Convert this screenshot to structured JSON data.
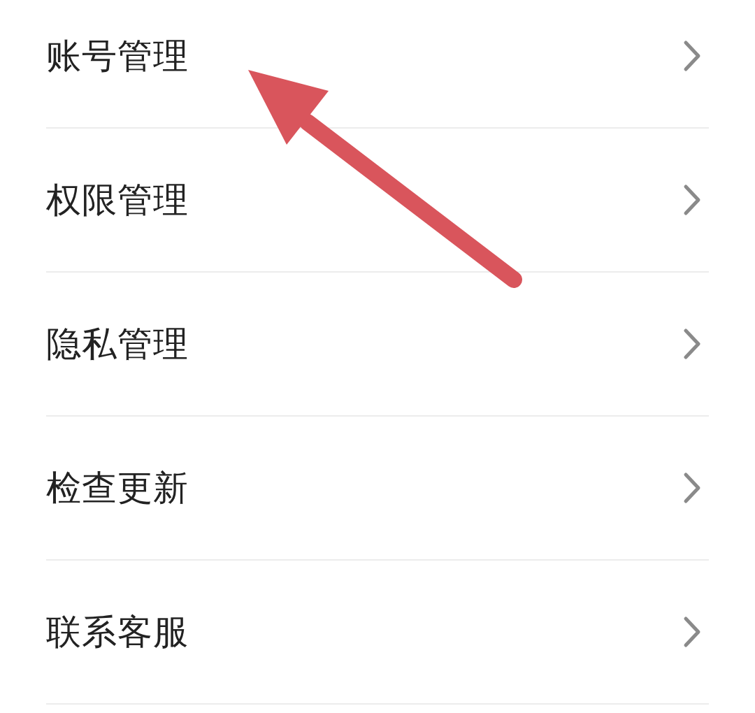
{
  "settings_list": {
    "items": [
      {
        "label": "账号管理"
      },
      {
        "label": "权限管理"
      },
      {
        "label": "隐私管理"
      },
      {
        "label": "检查更新"
      },
      {
        "label": "联系客服"
      }
    ]
  }
}
